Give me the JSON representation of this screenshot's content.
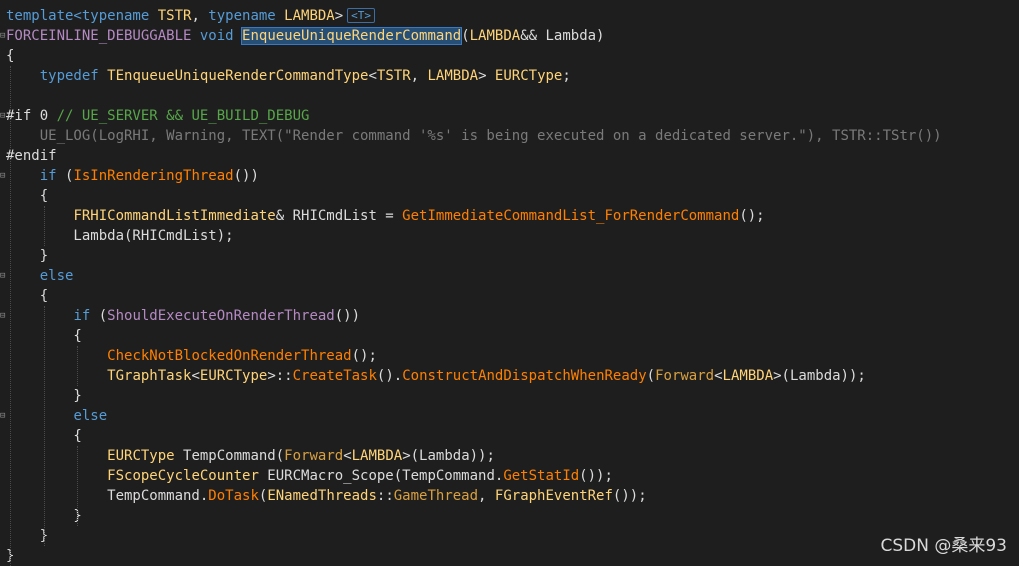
{
  "colors": {
    "background": "#1e1e1e",
    "keyword": "#569cd6",
    "type": "#ffd479",
    "function": "#ff8000",
    "function_alt": "#d9a040",
    "string": "#c8a88a",
    "macro": "#b58ac3",
    "comment": "#57a64a",
    "default": "#dcdcdc",
    "disabled": "#7a7a7a"
  },
  "template_hint": "<T>",
  "watermark": "CSDN @桑来93",
  "code_lines": [
    {
      "tokens": [
        [
          "template<typename ",
          "k"
        ],
        [
          "TSTR",
          "t"
        ],
        [
          ", ",
          "d"
        ],
        [
          "typename ",
          "k"
        ],
        [
          "LAMBDA",
          "t"
        ],
        [
          ">",
          "d"
        ]
      ],
      "hint": true
    },
    {
      "tokens": [
        [
          "FORCEINLINE_DEBUGGABLE",
          "m"
        ],
        [
          " ",
          "d"
        ],
        [
          "void",
          "k"
        ],
        [
          " ",
          "d"
        ],
        [
          "EnqueueUniqueRenderCommand",
          "fs"
        ],
        [
          "(",
          "d"
        ],
        [
          "LAMBDA",
          "t"
        ],
        [
          "&& Lambda)",
          "d"
        ]
      ]
    },
    {
      "tokens": [
        [
          "{",
          "d"
        ]
      ]
    },
    {
      "tokens": [
        [
          "    ",
          "d"
        ],
        [
          "typedef",
          "k"
        ],
        [
          " ",
          "d"
        ],
        [
          "TEnqueueUniqueRenderCommandType",
          "t"
        ],
        [
          "<",
          "d"
        ],
        [
          "TSTR",
          "t"
        ],
        [
          ", ",
          "d"
        ],
        [
          "LAMBDA",
          "t"
        ],
        [
          "> ",
          "d"
        ],
        [
          "EURCType",
          "t"
        ],
        [
          ";",
          "d"
        ]
      ]
    },
    {
      "tokens": [
        [
          "",
          "d"
        ]
      ]
    },
    {
      "tokens": [
        [
          "#if 0 ",
          "d"
        ],
        [
          "// UE_SERVER && UE_BUILD_DEBUG",
          "c"
        ]
      ]
    },
    {
      "tokens": [
        [
          "    UE_LOG(LogRHI, Warning, TEXT(\"Render command '%s' is being executed on a dedicated server.\"), TSTR::TStr())",
          "x"
        ]
      ]
    },
    {
      "tokens": [
        [
          "#endif",
          "d"
        ]
      ]
    },
    {
      "tokens": [
        [
          "    ",
          "d"
        ],
        [
          "if",
          "k"
        ],
        [
          " (",
          "d"
        ],
        [
          "IsInRenderingThread",
          "f"
        ],
        [
          "())",
          "d"
        ]
      ]
    },
    {
      "tokens": [
        [
          "    {",
          "d"
        ]
      ]
    },
    {
      "tokens": [
        [
          "        ",
          "d"
        ],
        [
          "FRHICommandListImmediate",
          "t"
        ],
        [
          "& RHICmdList = ",
          "d"
        ],
        [
          "GetImmediateCommandList_ForRenderCommand",
          "f"
        ],
        [
          "();",
          "d"
        ]
      ]
    },
    {
      "tokens": [
        [
          "        Lambda(RHICmdList);",
          "d"
        ]
      ]
    },
    {
      "tokens": [
        [
          "    }",
          "d"
        ]
      ]
    },
    {
      "tokens": [
        [
          "    ",
          "d"
        ],
        [
          "else",
          "k"
        ]
      ]
    },
    {
      "tokens": [
        [
          "    {",
          "d"
        ]
      ]
    },
    {
      "tokens": [
        [
          "        ",
          "d"
        ],
        [
          "if",
          "k"
        ],
        [
          " (",
          "d"
        ],
        [
          "ShouldExecuteOnRenderThread",
          "m"
        ],
        [
          "())",
          "d"
        ]
      ]
    },
    {
      "tokens": [
        [
          "        {",
          "d"
        ]
      ]
    },
    {
      "tokens": [
        [
          "            ",
          "d"
        ],
        [
          "CheckNotBlockedOnRenderThread",
          "f"
        ],
        [
          "();",
          "d"
        ]
      ]
    },
    {
      "tokens": [
        [
          "            ",
          "d"
        ],
        [
          "TGraphTask",
          "t"
        ],
        [
          "<",
          "d"
        ],
        [
          "EURCType",
          "t"
        ],
        [
          ">::",
          "d"
        ],
        [
          "CreateTask",
          "f"
        ],
        [
          "().",
          "d"
        ],
        [
          "ConstructAndDispatchWhenReady",
          "f"
        ],
        [
          "(",
          "d"
        ],
        [
          "Forward",
          "f2"
        ],
        [
          "<",
          "d"
        ],
        [
          "LAMBDA",
          "t"
        ],
        [
          ">(Lambda));",
          "d"
        ]
      ]
    },
    {
      "tokens": [
        [
          "        }",
          "d"
        ]
      ]
    },
    {
      "tokens": [
        [
          "        ",
          "d"
        ],
        [
          "else",
          "k"
        ]
      ]
    },
    {
      "tokens": [
        [
          "        {",
          "d"
        ]
      ]
    },
    {
      "tokens": [
        [
          "            ",
          "d"
        ],
        [
          "EURCType",
          "t"
        ],
        [
          " TempCommand(",
          "d"
        ],
        [
          "Forward",
          "f2"
        ],
        [
          "<",
          "d"
        ],
        [
          "LAMBDA",
          "t"
        ],
        [
          ">(Lambda));",
          "d"
        ]
      ]
    },
    {
      "tokens": [
        [
          "            ",
          "d"
        ],
        [
          "FScopeCycleCounter",
          "t"
        ],
        [
          " EURCMacro_Scope(TempCommand.",
          "d"
        ],
        [
          "GetStatId",
          "f"
        ],
        [
          "());",
          "d"
        ]
      ]
    },
    {
      "tokens": [
        [
          "            TempCommand.",
          "d"
        ],
        [
          "DoTask",
          "f"
        ],
        [
          "(",
          "d"
        ],
        [
          "ENamedThreads",
          "t"
        ],
        [
          "::",
          "d"
        ],
        [
          "GameThread",
          "f2"
        ],
        [
          ", ",
          "d"
        ],
        [
          "FGraphEventRef",
          "t"
        ],
        [
          "());",
          "d"
        ]
      ]
    },
    {
      "tokens": [
        [
          "        }",
          "d"
        ]
      ]
    },
    {
      "tokens": [
        [
          "    }",
          "d"
        ]
      ]
    },
    {
      "tokens": [
        [
          "}",
          "d"
        ]
      ]
    }
  ]
}
